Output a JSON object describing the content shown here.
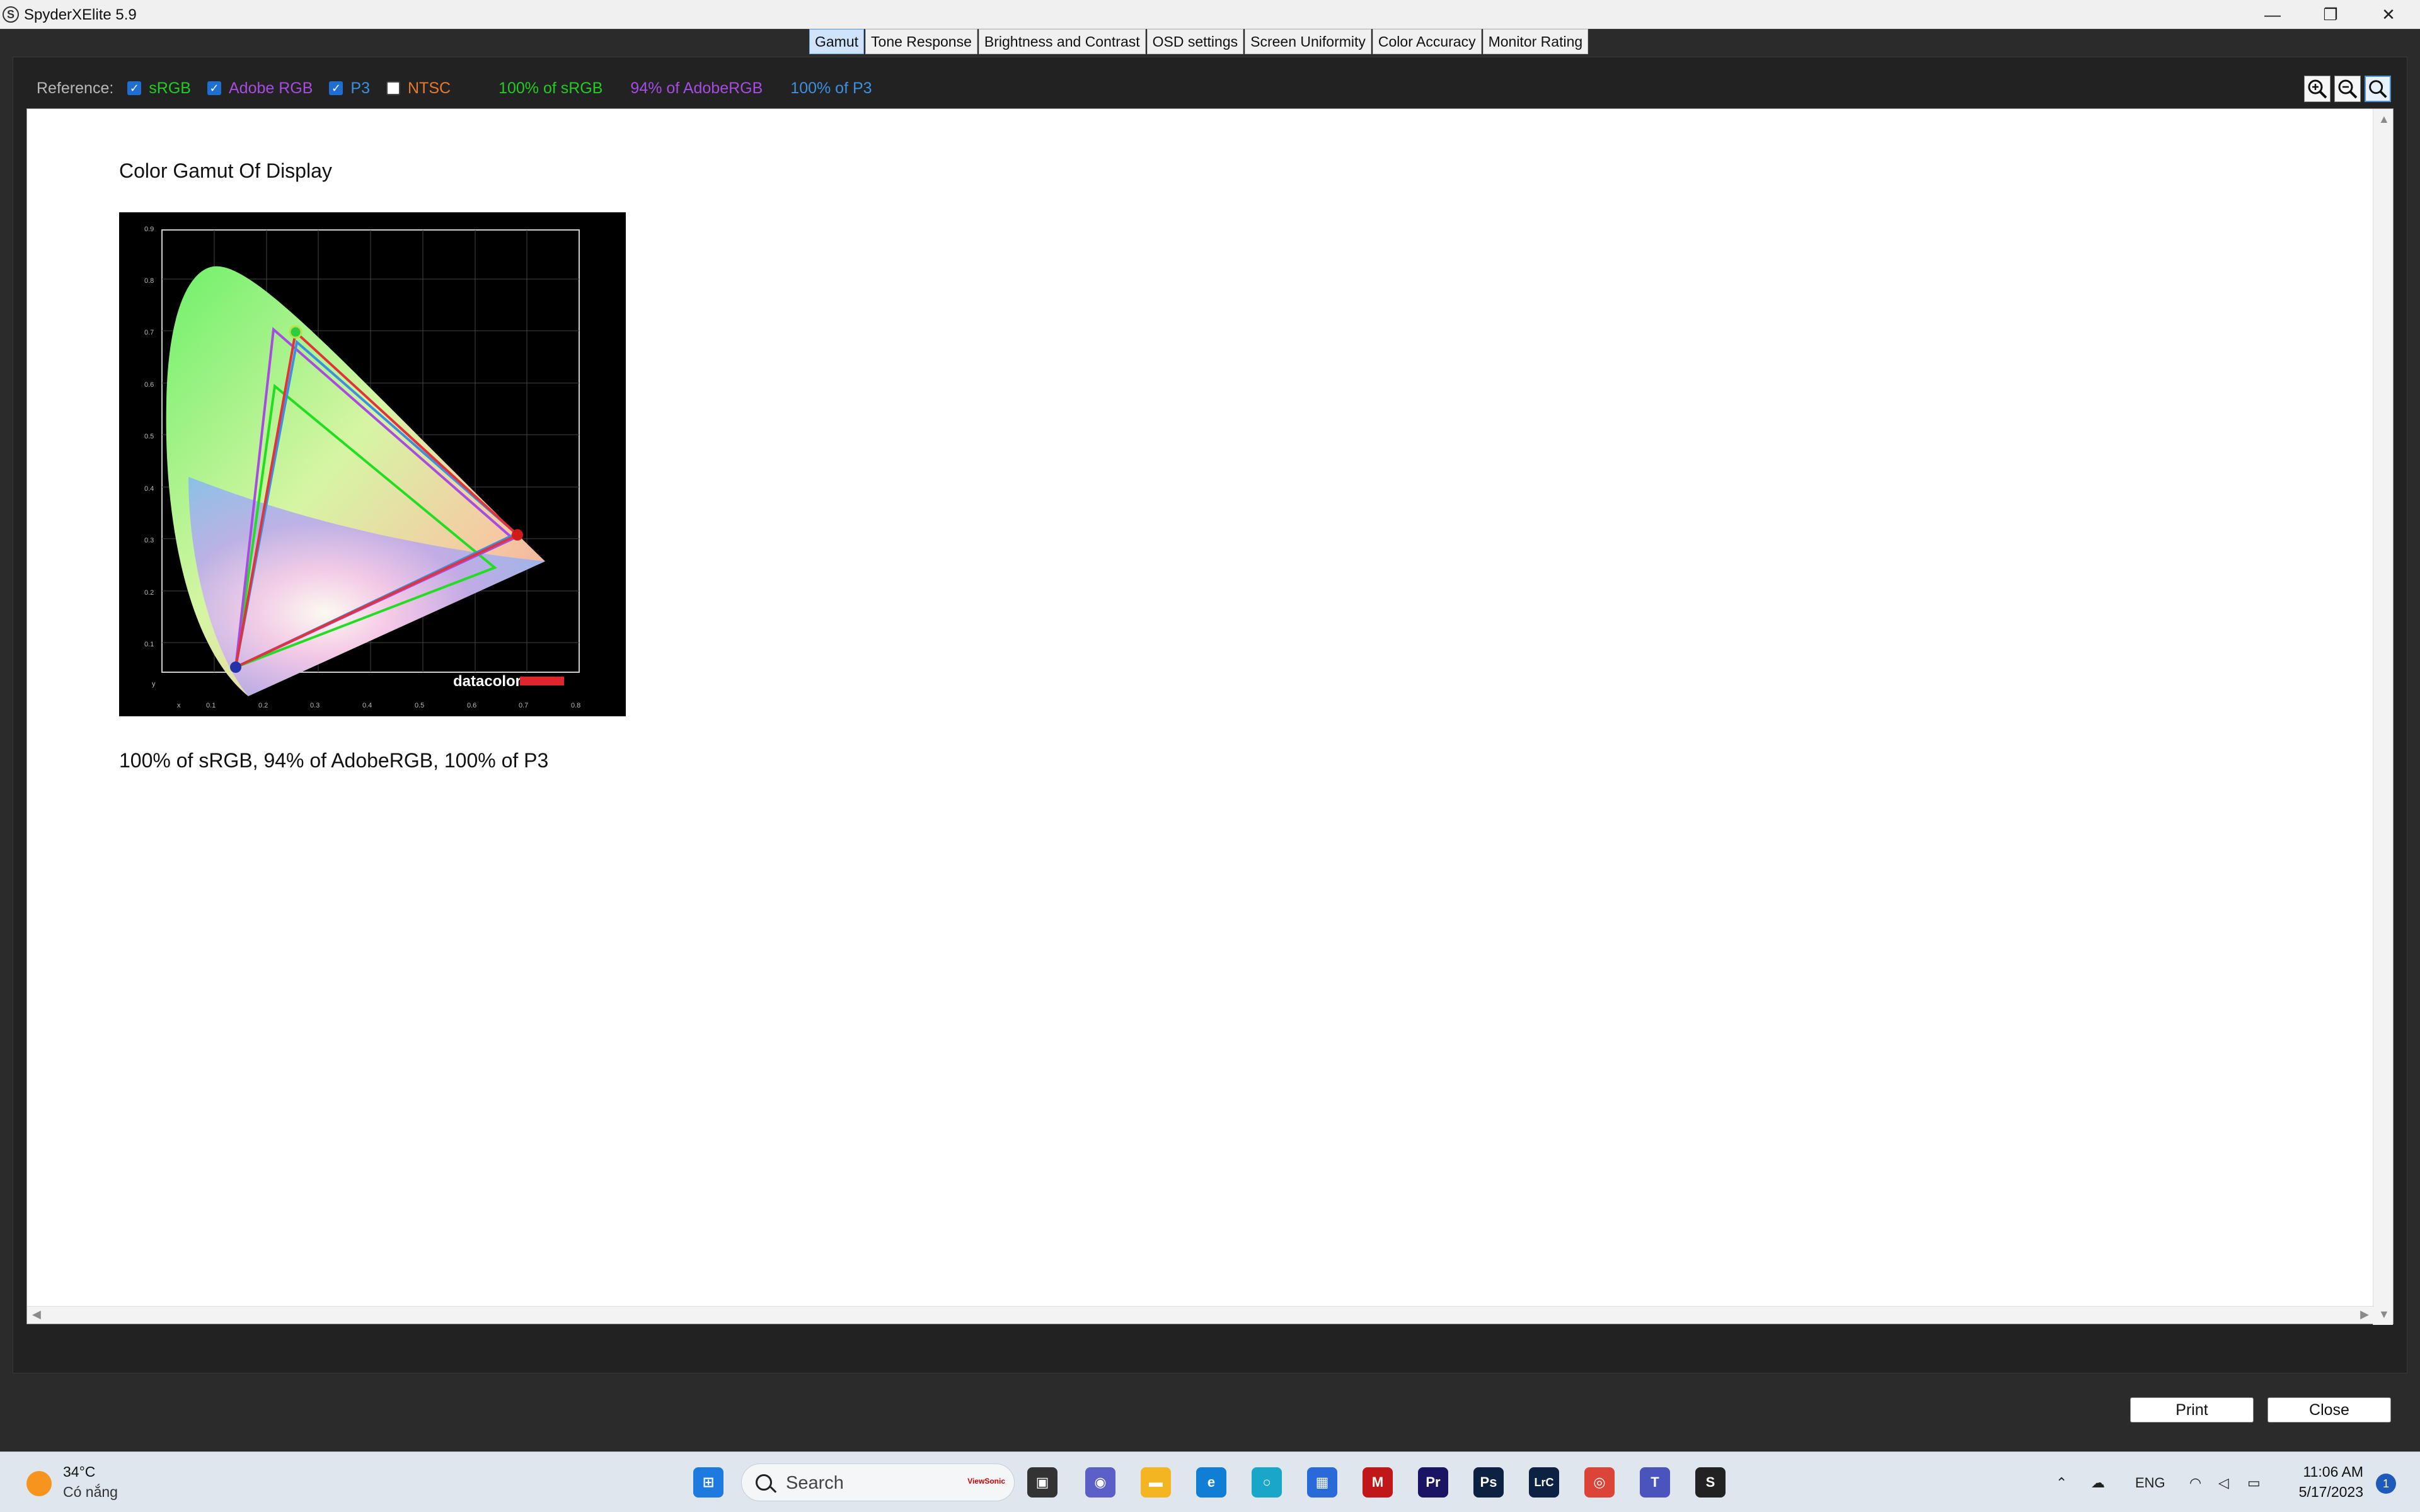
{
  "window": {
    "title": "SpyderXElite 5.9",
    "app_icon_letter": "S",
    "minimize": "—",
    "restore": "❐",
    "close": "✕"
  },
  "tabs": [
    {
      "label": "Gamut",
      "active": true
    },
    {
      "label": "Tone Response",
      "active": false
    },
    {
      "label": "Brightness and Contrast",
      "active": false
    },
    {
      "label": "OSD settings",
      "active": false
    },
    {
      "label": "Screen Uniformity",
      "active": false
    },
    {
      "label": "Color Accuracy",
      "active": false
    },
    {
      "label": "Monitor Rating",
      "active": false
    }
  ],
  "reference": {
    "label": "Reference:",
    "items": [
      {
        "label": "sRGB",
        "checked": true,
        "color": "#22cc22"
      },
      {
        "label": "Adobe RGB",
        "checked": true,
        "color": "#a64ce0"
      },
      {
        "label": "P3",
        "checked": true,
        "color": "#3d8fe0"
      },
      {
        "label": "NTSC",
        "checked": false,
        "color": "#e87a2a"
      }
    ],
    "results": [
      {
        "text": "100% of sRGB",
        "color": "#22cc22"
      },
      {
        "text": "94% of AdobeRGB",
        "color": "#a64ce0"
      },
      {
        "text": "100% of P3",
        "color": "#3d8fe0"
      }
    ]
  },
  "zoom_icons": [
    "zoom-in-icon",
    "zoom-out-icon",
    "zoom-fit-icon"
  ],
  "report": {
    "title": "Color Gamut Of Display",
    "caption": "100% of sRGB, 94% of AdobeRGB, 100% of P3",
    "chart": {
      "y_ticks": [
        "0.9",
        "0.8",
        "0.7",
        "0.6",
        "0.5",
        "0.4",
        "0.3",
        "0.2",
        "0.1",
        "y"
      ],
      "x_ticks": [
        "x",
        "0.1",
        "0.2",
        "0.3",
        "0.4",
        "0.5",
        "0.6",
        "0.7",
        "0.8"
      ],
      "logo": "datacolor"
    }
  },
  "buttons": {
    "print": "Print",
    "close": "Close"
  },
  "taskbar": {
    "temperature": "34°C",
    "weather": "Có nắng",
    "search_placeholder": "Search",
    "search_badge": "ViewSonic",
    "apps": [
      {
        "icon": "windows-start-icon",
        "color": "#1f7ae0",
        "glyph": "⊞"
      },
      {
        "icon": "task-view-icon",
        "color": "#333333",
        "glyph": "▣"
      },
      {
        "icon": "teams-chat-icon",
        "color": "#5b5fc7",
        "glyph": "◉"
      },
      {
        "icon": "file-explorer-icon",
        "color": "#f3b622",
        "glyph": "▬"
      },
      {
        "icon": "edge-icon",
        "color": "#0f7ed4",
        "glyph": "e"
      },
      {
        "icon": "cortana-icon",
        "color": "#1aa6c9",
        "glyph": "○"
      },
      {
        "icon": "store-icon",
        "color": "#2a6ad8",
        "glyph": "▦"
      },
      {
        "icon": "mcafee-icon",
        "color": "#c01818",
        "glyph": "M"
      },
      {
        "icon": "premiere-icon",
        "color": "#1b1464",
        "glyph": "Pr"
      },
      {
        "icon": "photoshop-icon",
        "color": "#0b2242",
        "glyph": "Ps"
      },
      {
        "icon": "lightroom-classic-icon",
        "color": "#0b2242",
        "glyph": "LrC"
      },
      {
        "icon": "chrome-icon",
        "color": "#db4437",
        "glyph": "◎"
      },
      {
        "icon": "teams-icon",
        "color": "#4b53bc",
        "glyph": "T"
      },
      {
        "icon": "spyder-icon",
        "color": "#222222",
        "glyph": "S"
      }
    ],
    "tray_language": "ENG",
    "time": "11:06 AM",
    "date": "5/17/2023",
    "notifications": "1"
  }
}
